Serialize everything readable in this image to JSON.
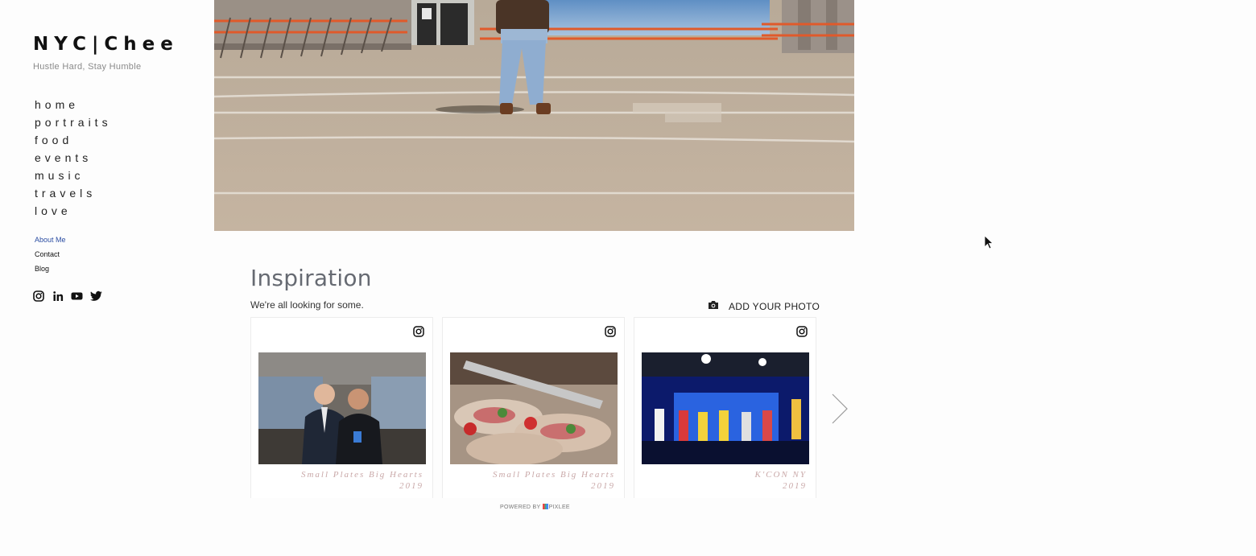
{
  "site": {
    "brand": "NYC|Chee",
    "tagline": "Hustle Hard, Stay Humble"
  },
  "nav": [
    {
      "label": "home"
    },
    {
      "label": "portraits"
    },
    {
      "label": "food"
    },
    {
      "label": "events"
    },
    {
      "label": "music"
    },
    {
      "label": "travels"
    },
    {
      "label": "love"
    }
  ],
  "subnav": [
    {
      "label": "About Me",
      "active": true
    },
    {
      "label": "Contact",
      "active": false
    },
    {
      "label": "Blog",
      "active": false
    }
  ],
  "social": [
    "instagram-icon",
    "linkedin-icon",
    "youtube-icon",
    "twitter-icon"
  ],
  "widget": {
    "title": "Inspiration",
    "subtitle": "We're all looking for some.",
    "add_photo_label": "ADD YOUR PHOTO",
    "powered_prefix": "POWERED BY",
    "powered_brand": "PIXLEE",
    "cards": [
      {
        "caption_line1": "Small Plates Big Hearts",
        "caption_line2": "2019",
        "source_icon": "instagram-icon"
      },
      {
        "caption_line1": "Small Plates Big Hearts",
        "caption_line2": "2019",
        "source_icon": "instagram-icon"
      },
      {
        "caption_line1": "K'CON NY",
        "caption_line2": "2019",
        "source_icon": "instagram-icon"
      }
    ]
  },
  "colors": {
    "background": "#fdfdfd",
    "active_link": "#2c4ea3",
    "caption": "#c9a8a8",
    "railing": "#e05a2b"
  }
}
